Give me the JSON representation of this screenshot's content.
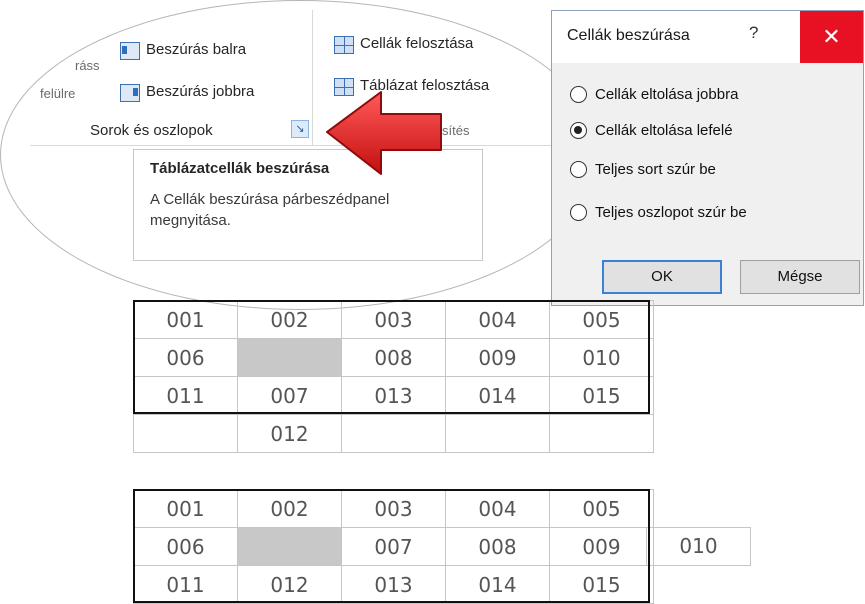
{
  "ribbon": {
    "group_label": "Sorok és oszlopok",
    "insert_left": "Beszúrás balra",
    "insert_right": "Beszúrás jobbra",
    "partial_left_1": "ráss",
    "partial_left_2": "felülre",
    "split_cells": "Cellák felosztása",
    "split_table": "Táblázat felosztása",
    "partial_merge": "sítés",
    "launcher_glyph": "↘"
  },
  "tooltip": {
    "title": "Táblázatcellák beszúrása",
    "text": "A Cellák beszúrása párbeszédpanel megnyitása."
  },
  "dialog": {
    "title": "Cellák beszúrása",
    "help": "?",
    "close": "✕",
    "options": [
      {
        "label": "Cellák eltolása jobbra",
        "selected": false
      },
      {
        "label": "Cellák eltolása lefelé",
        "selected": true
      },
      {
        "label": "Teljes sort szúr be",
        "selected": false
      },
      {
        "label": "Teljes oszlopot szúr be",
        "selected": false
      }
    ],
    "ok": "OK",
    "cancel": "Mégse"
  },
  "table_top": {
    "rows": [
      [
        "001",
        "002",
        "003",
        "004",
        "005"
      ],
      [
        "006",
        "",
        "008",
        "009",
        "010"
      ],
      [
        "011",
        "007",
        "013",
        "014",
        "015"
      ],
      [
        "",
        "012",
        "",
        "",
        ""
      ]
    ]
  },
  "table_bottom": {
    "rows": [
      [
        "001",
        "002",
        "003",
        "004",
        "005"
      ],
      [
        "006",
        "",
        "007",
        "008",
        "009"
      ],
      [
        "011",
        "012",
        "013",
        "014",
        "015"
      ]
    ],
    "overflow_cell": "010"
  },
  "icons": {
    "insert_left": "insert-column-left-icon",
    "insert_right": "insert-column-right-icon",
    "split_cells": "split-cells-icon",
    "split_table": "split-table-icon",
    "pointer": "red-arrow-pointer-icon"
  },
  "colors": {
    "close_button": "#e81123",
    "arrow_red": "#e01b1b",
    "empty_cell": "#c8c8c8"
  }
}
